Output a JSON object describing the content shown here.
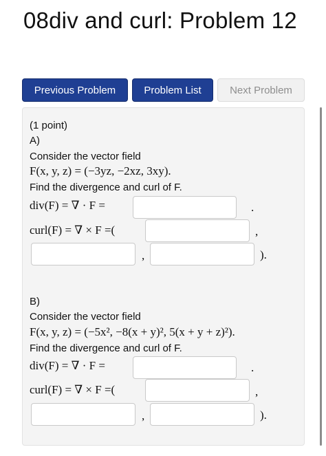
{
  "title": "08div and curl: Problem 12",
  "nav": {
    "previous": "Previous Problem",
    "list": "Problem List",
    "next": "Next Problem"
  },
  "problem": {
    "points": "(1 point)",
    "parts": [
      {
        "label": "A)",
        "intro": "Consider the vector field",
        "field": "F(x, y, z) = (−3yz, −2xz, 3xy).",
        "instruction": "Find the divergence and curl of F.",
        "div_label": "div(F) = ∇ · F =",
        "div_end": ".",
        "curl_label": "curl(F) = ∇ × F =(",
        "sep1": ",",
        "sep2": ",",
        "curl_end": ")."
      },
      {
        "label": "B)",
        "intro": "Consider the vector field",
        "field": "F(x, y, z) = (−5x², −8(x + y)², 5(x + y + z)²).",
        "instruction": "Find the divergence and curl of F.",
        "div_label": "div(F) = ∇ · F =",
        "div_end": ".",
        "curl_label": "curl(F) = ∇ × F =(",
        "sep1": ",",
        "sep2": ",",
        "curl_end": ")."
      }
    ]
  },
  "colors": {
    "primary_button": "#1f3f93",
    "disabled_button": "#f1f1f1",
    "panel_background": "#f4f4f4"
  }
}
